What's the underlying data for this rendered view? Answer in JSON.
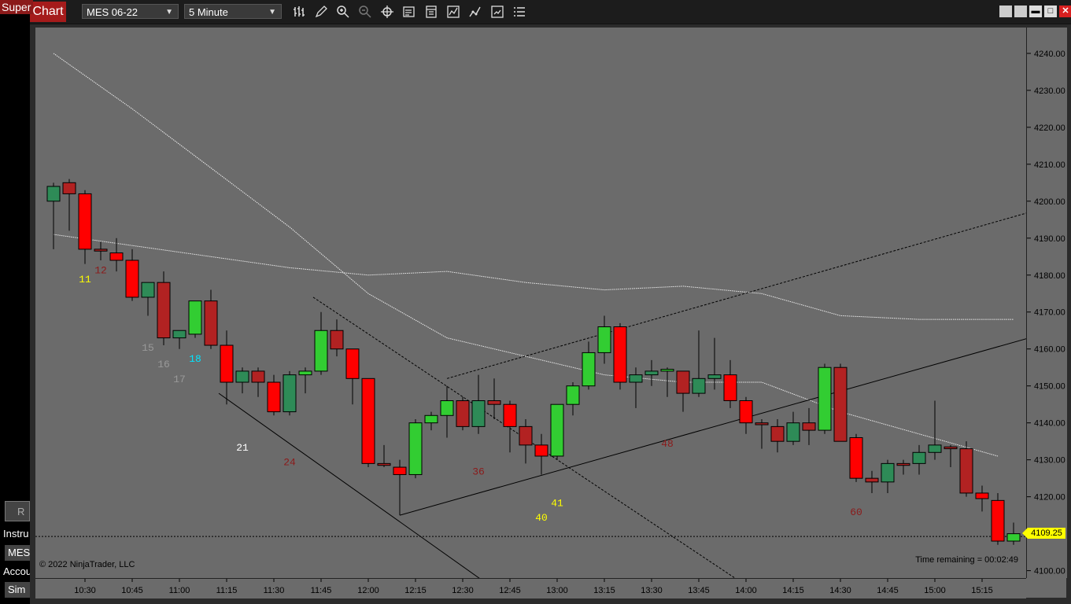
{
  "left_panel": {
    "super_tab": "Super",
    "r_button": "R",
    "instrument_label": "Instru",
    "instrument_value": "MES",
    "account_label": "Accou",
    "account_value": "Sim"
  },
  "window": {
    "tab_title": "Chart",
    "instrument": "MES 06-22",
    "interval": "5 Minute",
    "toolbar_icons": [
      "bar-type-icon",
      "pencil-icon",
      "zoom-in-icon",
      "zoom-out-icon",
      "crosshair-icon",
      "data-box-icon",
      "properties-icon",
      "indicators-icon",
      "strategies-icon",
      "templates-icon",
      "menu-list-icon"
    ],
    "window_buttons": [
      "tile-icon",
      "tile-icon",
      "minimize-icon",
      "maximize-icon",
      "close-icon"
    ]
  },
  "chart": {
    "copyright": "© 2022 NinjaTrader, LLC",
    "time_remaining": "Time remaining = 00:02:49",
    "last_price": "4109.25",
    "colors": {
      "background": "#6b6b6b",
      "up_body": "#2e8b57",
      "down_body": "#b22222",
      "bright_up": "#32cd32",
      "bright_down": "#ff0000"
    }
  },
  "chart_data": {
    "type": "candlestick",
    "ylim": [
      4098,
      4247
    ],
    "price_ticks": [
      "4240.00",
      "4230.00",
      "4220.00",
      "4210.00",
      "4200.00",
      "4190.00",
      "4180.00",
      "4170.00",
      "4160.00",
      "4150.00",
      "4140.00",
      "4130.00",
      "4120.00",
      "4110.00",
      "4100.00"
    ],
    "time_ticks": [
      "10:30",
      "10:45",
      "11:00",
      "11:15",
      "11:30",
      "11:45",
      "12:00",
      "12:15",
      "12:30",
      "12:45",
      "13:00",
      "13:15",
      "13:30",
      "13:45",
      "14:00",
      "14:15",
      "14:30",
      "14:45",
      "15:00",
      "15:15"
    ],
    "bar_count_labels": [
      {
        "text": "11",
        "bar": 2,
        "price": 4178,
        "color": "#ffff00"
      },
      {
        "text": "12",
        "bar": 3,
        "price": 4180.5,
        "color": "#8b1a1a"
      },
      {
        "text": "15",
        "bar": 6,
        "price": 4159.5,
        "color": "#999999"
      },
      {
        "text": "16",
        "bar": 7,
        "price": 4155,
        "color": "#999999"
      },
      {
        "text": "17",
        "bar": 8,
        "price": 4151,
        "color": "#999999"
      },
      {
        "text": "18",
        "bar": 9,
        "price": 4156.5,
        "color": "#00e5ff"
      },
      {
        "text": "21",
        "bar": 12,
        "price": 4132.5,
        "color": "#ffffff"
      },
      {
        "text": "24",
        "bar": 15,
        "price": 4128.5,
        "color": "#8b1a1a"
      },
      {
        "text": "36",
        "bar": 27,
        "price": 4126,
        "color": "#8b1a1a"
      },
      {
        "text": "40",
        "bar": 31,
        "price": 4113.5,
        "color": "#ffff00"
      },
      {
        "text": "41",
        "bar": 32,
        "price": 4117.5,
        "color": "#ffff00"
      },
      {
        "text": "48",
        "bar": 39,
        "price": 4133.5,
        "color": "#8b1a1a"
      },
      {
        "text": "60",
        "bar": 51,
        "price": 4115,
        "color": "#8b1a1a"
      }
    ],
    "candles": [
      {
        "t": "10:20",
        "o": 4200,
        "h": 4205,
        "l": 4187,
        "c": 4204,
        "s": "up"
      },
      {
        "t": "10:25",
        "o": 4205,
        "h": 4206,
        "l": 4192,
        "c": 4202,
        "s": "down"
      },
      {
        "t": "10:30",
        "o": 4202,
        "h": 4203,
        "l": 4183,
        "c": 4187,
        "s": "bright_down"
      },
      {
        "t": "10:35",
        "o": 4187,
        "h": 4189,
        "l": 4184,
        "c": 4186.5,
        "s": "down"
      },
      {
        "t": "10:40",
        "o": 4186,
        "h": 4190,
        "l": 4181,
        "c": 4184,
        "s": "bright_down"
      },
      {
        "t": "10:45",
        "o": 4184,
        "h": 4187,
        "l": 4173,
        "c": 4174,
        "s": "bright_down"
      },
      {
        "t": "10:50",
        "o": 4174,
        "h": 4178,
        "l": 4169,
        "c": 4178,
        "s": "up"
      },
      {
        "t": "10:55",
        "o": 4178,
        "h": 4181,
        "l": 4161,
        "c": 4163,
        "s": "down"
      },
      {
        "t": "11:00",
        "o": 4163,
        "h": 4164,
        "l": 4160,
        "c": 4165,
        "s": "up"
      },
      {
        "t": "11:05",
        "o": 4164,
        "h": 4173,
        "l": 4163,
        "c": 4173,
        "s": "bright_up"
      },
      {
        "t": "11:10",
        "o": 4173,
        "h": 4176,
        "l": 4160,
        "c": 4161,
        "s": "down"
      },
      {
        "t": "11:15",
        "o": 4161,
        "h": 4165,
        "l": 4145,
        "c": 4151,
        "s": "bright_down"
      },
      {
        "t": "11:20",
        "o": 4151,
        "h": 4155,
        "l": 4148,
        "c": 4154,
        "s": "up"
      },
      {
        "t": "11:25",
        "o": 4154,
        "h": 4155,
        "l": 4147,
        "c": 4151,
        "s": "down"
      },
      {
        "t": "11:30",
        "o": 4151,
        "h": 4153,
        "l": 4142,
        "c": 4143,
        "s": "bright_down"
      },
      {
        "t": "11:35",
        "o": 4143,
        "h": 4154,
        "l": 4142,
        "c": 4153,
        "s": "up"
      },
      {
        "t": "11:40",
        "o": 4153,
        "h": 4155,
        "l": 4148,
        "c": 4154,
        "s": "bright_up"
      },
      {
        "t": "11:45",
        "o": 4154,
        "h": 4170,
        "l": 4153,
        "c": 4165,
        "s": "bright_up"
      },
      {
        "t": "11:50",
        "o": 4165,
        "h": 4168,
        "l": 4158,
        "c": 4160,
        "s": "down"
      },
      {
        "t": "11:55",
        "o": 4160,
        "h": 4160,
        "l": 4145,
        "c": 4152,
        "s": "bright_down"
      },
      {
        "t": "12:00",
        "o": 4152,
        "h": 4152,
        "l": 4128,
        "c": 4129,
        "s": "bright_down"
      },
      {
        "t": "12:05",
        "o": 4129,
        "h": 4134,
        "l": 4128,
        "c": 4128.5,
        "s": "down"
      },
      {
        "t": "12:10",
        "o": 4128,
        "h": 4130,
        "l": 4115,
        "c": 4126,
        "s": "bright_down"
      },
      {
        "t": "12:15",
        "o": 4126,
        "h": 4141,
        "l": 4125,
        "c": 4140,
        "s": "bright_up"
      },
      {
        "t": "12:20",
        "o": 4140,
        "h": 4143,
        "l": 4138,
        "c": 4142,
        "s": "bright_up"
      },
      {
        "t": "12:25",
        "o": 4142,
        "h": 4150,
        "l": 4136,
        "c": 4146,
        "s": "bright_up"
      },
      {
        "t": "12:30",
        "o": 4146,
        "h": 4147,
        "l": 4138,
        "c": 4139,
        "s": "down"
      },
      {
        "t": "12:35",
        "o": 4139,
        "h": 4153,
        "l": 4137,
        "c": 4146,
        "s": "up"
      },
      {
        "t": "12:40",
        "o": 4146,
        "h": 4152,
        "l": 4141,
        "c": 4145,
        "s": "down"
      },
      {
        "t": "12:45",
        "o": 4145,
        "h": 4146,
        "l": 4132,
        "c": 4139,
        "s": "bright_down"
      },
      {
        "t": "12:50",
        "o": 4139,
        "h": 4141,
        "l": 4129,
        "c": 4134,
        "s": "down"
      },
      {
        "t": "12:55",
        "o": 4134,
        "h": 4137,
        "l": 4126,
        "c": 4131,
        "s": "bright_down"
      },
      {
        "t": "13:00",
        "o": 4131,
        "h": 4145,
        "l": 4130,
        "c": 4145,
        "s": "bright_up"
      },
      {
        "t": "13:05",
        "o": 4145,
        "h": 4151,
        "l": 4142,
        "c": 4150,
        "s": "bright_up"
      },
      {
        "t": "13:10",
        "o": 4150,
        "h": 4162,
        "l": 4149,
        "c": 4159,
        "s": "bright_up"
      },
      {
        "t": "13:15",
        "o": 4159,
        "h": 4169,
        "l": 4156,
        "c": 4166,
        "s": "bright_up"
      },
      {
        "t": "13:20",
        "o": 4166,
        "h": 4167,
        "l": 4149,
        "c": 4151,
        "s": "bright_down"
      },
      {
        "t": "13:25",
        "o": 4151,
        "h": 4155,
        "l": 4144,
        "c": 4153,
        "s": "up"
      },
      {
        "t": "13:30",
        "o": 4153,
        "h": 4157,
        "l": 4150,
        "c": 4154,
        "s": "up"
      },
      {
        "t": "13:35",
        "o": 4154,
        "h": 4155,
        "l": 4147,
        "c": 4154.5,
        "s": "bright_up"
      },
      {
        "t": "13:40",
        "o": 4154,
        "h": 4154,
        "l": 4143,
        "c": 4148,
        "s": "down"
      },
      {
        "t": "13:45",
        "o": 4148,
        "h": 4165,
        "l": 4147,
        "c": 4152,
        "s": "up"
      },
      {
        "t": "13:50",
        "o": 4152,
        "h": 4163,
        "l": 4149,
        "c": 4153,
        "s": "up"
      },
      {
        "t": "13:55",
        "o": 4153,
        "h": 4157,
        "l": 4144,
        "c": 4146,
        "s": "bright_down"
      },
      {
        "t": "14:00",
        "o": 4146,
        "h": 4147,
        "l": 4137,
        "c": 4140,
        "s": "bright_down"
      },
      {
        "t": "14:05",
        "o": 4140,
        "h": 4141,
        "l": 4133,
        "c": 4139.5,
        "s": "down"
      },
      {
        "t": "14:10",
        "o": 4139,
        "h": 4141,
        "l": 4132,
        "c": 4135,
        "s": "down"
      },
      {
        "t": "14:15",
        "o": 4135,
        "h": 4143,
        "l": 4134,
        "c": 4140,
        "s": "up"
      },
      {
        "t": "14:20",
        "o": 4140,
        "h": 4144,
        "l": 4134,
        "c": 4138,
        "s": "down"
      },
      {
        "t": "14:25",
        "o": 4138,
        "h": 4156,
        "l": 4137,
        "c": 4155,
        "s": "bright_up"
      },
      {
        "t": "14:30",
        "o": 4155,
        "h": 4156,
        "l": 4136,
        "c": 4135,
        "s": "down"
      },
      {
        "t": "14:35",
        "o": 4136,
        "h": 4137,
        "l": 4124,
        "c": 4125,
        "s": "bright_down"
      },
      {
        "t": "14:40",
        "o": 4125,
        "h": 4127,
        "l": 4121,
        "c": 4124,
        "s": "down"
      },
      {
        "t": "14:45",
        "o": 4124,
        "h": 4130,
        "l": 4121,
        "c": 4129,
        "s": "up"
      },
      {
        "t": "14:50",
        "o": 4129,
        "h": 4130,
        "l": 4126,
        "c": 4128.5,
        "s": "down"
      },
      {
        "t": "14:55",
        "o": 4129,
        "h": 4134,
        "l": 4126,
        "c": 4132,
        "s": "up"
      },
      {
        "t": "15:00",
        "o": 4132,
        "h": 4146,
        "l": 4130,
        "c": 4134,
        "s": "up"
      },
      {
        "t": "15:05",
        "o": 4133,
        "h": 4134,
        "l": 4128,
        "c": 4133.5,
        "s": "down"
      },
      {
        "t": "15:10",
        "o": 4133,
        "h": 4135,
        "l": 4120,
        "c": 4121,
        "s": "down"
      },
      {
        "t": "15:15",
        "o": 4121,
        "h": 4123,
        "l": 4116,
        "c": 4119.5,
        "s": "bright_down"
      },
      {
        "t": "15:20",
        "o": 4119,
        "h": 4121,
        "l": 4107,
        "c": 4108,
        "s": "bright_down"
      },
      {
        "t": "15:25",
        "o": 4108,
        "h": 4113,
        "l": 4107,
        "c": 4110,
        "s": "bright_up"
      }
    ],
    "ma_fast": [
      [
        0,
        4240
      ],
      [
        5,
        4225
      ],
      [
        10,
        4209
      ],
      [
        15,
        4193
      ],
      [
        20,
        4175
      ],
      [
        25,
        4163
      ],
      [
        30,
        4158
      ],
      [
        35,
        4153
      ],
      [
        40,
        4151
      ],
      [
        45,
        4151
      ],
      [
        50,
        4143
      ],
      [
        55,
        4137
      ],
      [
        60,
        4131
      ]
    ],
    "ma_slow": [
      [
        0,
        4191
      ],
      [
        5,
        4188
      ],
      [
        10,
        4185
      ],
      [
        15,
        4182
      ],
      [
        20,
        4180
      ],
      [
        25,
        4181
      ],
      [
        30,
        4178
      ],
      [
        35,
        4176
      ],
      [
        40,
        4177
      ],
      [
        45,
        4175
      ],
      [
        50,
        4169
      ],
      [
        55,
        4168
      ],
      [
        61,
        4168
      ]
    ],
    "trendlines": [
      {
        "from": [
          10.5,
          4148
        ],
        "to": [
          27.7,
          4096
        ],
        "style": "solid"
      },
      {
        "from": [
          16.5,
          4174
        ],
        "to": [
          44,
          4096
        ],
        "style": "dashed"
      },
      {
        "from": [
          22,
          4115
        ],
        "to": [
          62,
          4163
        ],
        "style": "solid"
      },
      {
        "from": [
          25,
          4152
        ],
        "to": [
          62,
          4197
        ],
        "style": "dashed"
      }
    ],
    "last_price": 4109.25
  }
}
